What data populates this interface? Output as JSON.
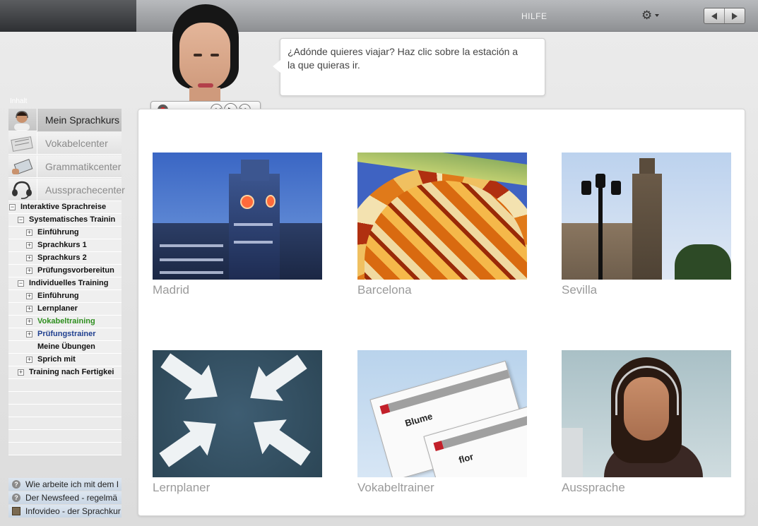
{
  "topbar": {
    "help_label": "HILFE",
    "settings_icon": "gear-icon",
    "back_icon": "arrow-left-icon",
    "forward_icon": "arrow-right-icon"
  },
  "bubble": {
    "text": "¿Adónde quieres viajar? Haz clic sobre la estación a la que quieras ir."
  },
  "player": {
    "record_icon": "record-icon",
    "rewind_icon": "rewind-icon",
    "play_icon": "play-icon",
    "forward_icon": "fast-forward-icon"
  },
  "sidebar": {
    "heading": "Inhalt",
    "menu": [
      {
        "label": "Mein Sprachkurs",
        "icon": "user-headset-icon",
        "active": true
      },
      {
        "label": "Vokabelcenter",
        "icon": "vocabulary-icon",
        "active": false
      },
      {
        "label": "Grammatikcenter",
        "icon": "grammar-icon",
        "active": false
      },
      {
        "label": "Aussprachecenter",
        "icon": "headset-icon",
        "active": false
      }
    ],
    "tree": [
      {
        "label": "Interaktive Sprachreise",
        "level": 0,
        "toggle": "−"
      },
      {
        "label": "Systematisches Trainin",
        "level": 1,
        "toggle": "−"
      },
      {
        "label": "Einführung",
        "level": 2,
        "toggle": "+"
      },
      {
        "label": "Sprachkurs 1",
        "level": 2,
        "toggle": "+"
      },
      {
        "label": "Sprachkurs 2",
        "level": 2,
        "toggle": "+"
      },
      {
        "label": "Prüfungsvorbereitun",
        "level": 2,
        "toggle": "+"
      },
      {
        "label": "Individuelles Training",
        "level": 1,
        "toggle": "−"
      },
      {
        "label": "Einführung",
        "level": 2,
        "toggle": "+"
      },
      {
        "label": "Lernplaner",
        "level": 2,
        "toggle": "+"
      },
      {
        "label": "Vokabeltraining",
        "level": 2,
        "toggle": "+",
        "color": "green"
      },
      {
        "label": "Prüfungstrainer",
        "level": 2,
        "toggle": "+",
        "color": "blue"
      },
      {
        "label": "Meine Übungen",
        "level": 2,
        "toggle": ""
      },
      {
        "label": "Sprich mit",
        "level": 2,
        "toggle": "+"
      },
      {
        "label": "Training nach Fertigkei",
        "level": 1,
        "toggle": "+"
      }
    ],
    "links": [
      {
        "label": "Wie arbeite ich mit dem I",
        "icon": "help-icon"
      },
      {
        "label": "Der Newsfeed - regelmä",
        "icon": "help-icon"
      },
      {
        "label": "Infovideo - der Sprachkur",
        "icon": "video-icon"
      }
    ]
  },
  "tiles": [
    {
      "caption": "Madrid"
    },
    {
      "caption": "Barcelona"
    },
    {
      "caption": "Sevilla"
    },
    {
      "caption": "Lernplaner"
    },
    {
      "caption": "Vokabeltrainer",
      "word1": "Blume",
      "word2": "flor"
    },
    {
      "caption": "Aussprache"
    }
  ]
}
